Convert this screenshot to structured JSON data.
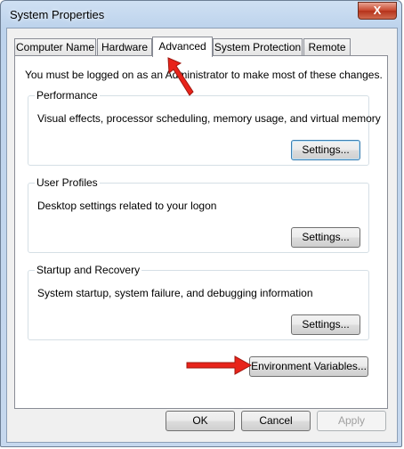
{
  "window": {
    "title": "System Properties",
    "close_label": "X"
  },
  "tabs": [
    {
      "label": "Computer Name"
    },
    {
      "label": "Hardware"
    },
    {
      "label": "Advanced"
    },
    {
      "label": "System Protection"
    },
    {
      "label": "Remote"
    }
  ],
  "active_tab": "Advanced",
  "notice": "You must be logged on as an Administrator to make most of these changes.",
  "groups": [
    {
      "title": "Performance",
      "description": "Visual effects, processor scheduling, memory usage, and virtual memory",
      "button": "Settings..."
    },
    {
      "title": "User Profiles",
      "description": "Desktop settings related to your logon",
      "button": "Settings..."
    },
    {
      "title": "Startup and Recovery",
      "description": "System startup, system failure, and debugging information",
      "button": "Settings..."
    }
  ],
  "env_button": "Environment Variables...",
  "footer": {
    "ok": "OK",
    "cancel": "Cancel",
    "apply": "Apply"
  },
  "annotation_color": "#e8231a"
}
